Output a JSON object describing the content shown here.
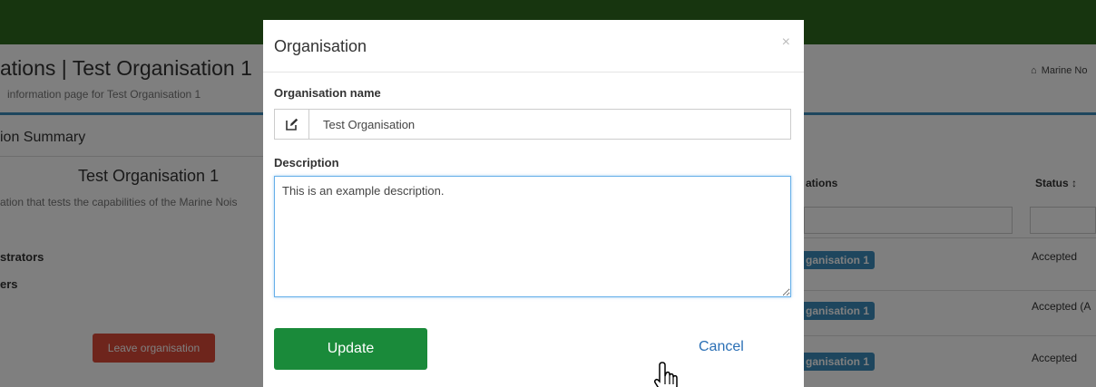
{
  "background": {
    "page_title": "ations | Test Organisation 1",
    "page_subtitle": "information page for Test Organisation 1",
    "breadcrumb": {
      "icon": "home-icon",
      "text": "Marine No"
    },
    "summary_heading": "ion Summary",
    "org_heading": "Test Organisation 1",
    "org_description": "ation that tests the capabilities of the Marine Nois",
    "label_administrators": "strators",
    "label_users": "ers",
    "leave_button": "Leave organisation",
    "table": {
      "headers": [
        "ations",
        "Status ↕"
      ],
      "rows": [
        {
          "org": "ganisation 1",
          "status": "Accepted"
        },
        {
          "org": "ganisation 1",
          "status": "Accepted (A"
        },
        {
          "org": "ganisation 1",
          "status": "Accepted"
        }
      ]
    }
  },
  "modal": {
    "title": "Organisation",
    "close_symbol": "×",
    "name_label": "Organisation name",
    "name_icon": "edit-icon",
    "name_value": "Test Organisation",
    "description_label": "Description",
    "description_value": "This is an example description.",
    "update_label": "Update",
    "cancel_label": "Cancel"
  },
  "colors": {
    "topbar": "#2e6a1f",
    "update_button": "#1a8a3a",
    "leave_button": "#dd4b39",
    "badge": "#3c8dbc",
    "cancel_link": "#2a6fb5"
  }
}
